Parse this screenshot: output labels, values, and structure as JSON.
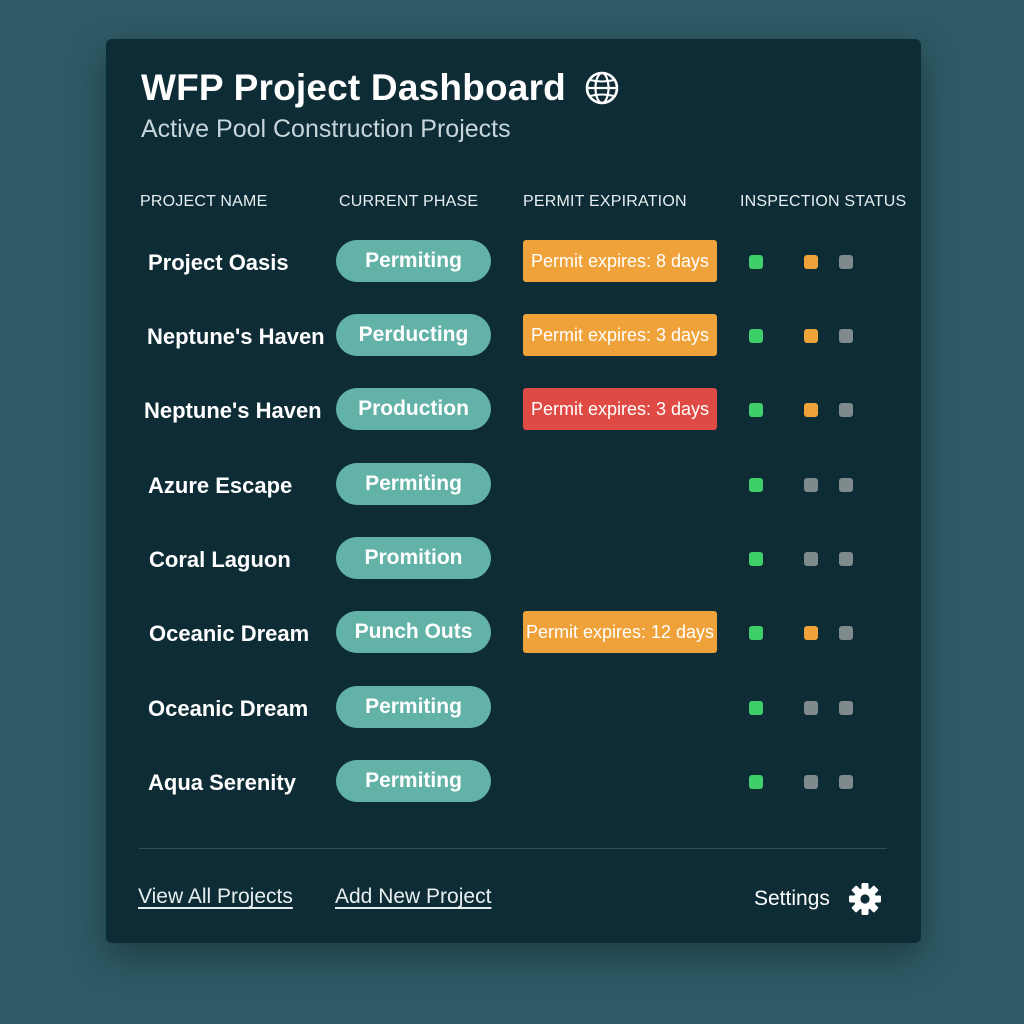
{
  "header": {
    "title": "WFP Project Dashboard",
    "subtitle": "Active Pool Construction Projects",
    "globe_icon": "globe-icon"
  },
  "columns": {
    "project_name": "PROJECT NAME",
    "current_phase": "CURRENT PHASE",
    "permit_expiration": "PERMIT EXPIRATION",
    "inspection_status": "INSPECTION STATUS"
  },
  "colors": {
    "background": "#2e5b66",
    "card": "#0e2c35",
    "phase_pill": "#62b2a7",
    "permit_warning": "#f0a23a",
    "permit_urgent": "#e04a45",
    "status_green": "#3ecf6a",
    "status_orange": "#f0a23a",
    "status_gray": "#7f8a8d"
  },
  "projects": [
    {
      "name": "Project Oasis",
      "phase": "Permiting",
      "permit": "Permit expires: 8 days",
      "permit_level": "warning",
      "inspection": [
        "green",
        "orange",
        "gray"
      ]
    },
    {
      "name": "Neptune's Haven",
      "phase": "Perducting",
      "permit": "Permit expires: 3 days",
      "permit_level": "warning",
      "inspection": [
        "green",
        "orange",
        "gray"
      ]
    },
    {
      "name": "Neptune's Haven",
      "phase": "Production",
      "permit": "Permit expires: 3 days",
      "permit_level": "urgent",
      "inspection": [
        "green",
        "orange",
        "gray"
      ]
    },
    {
      "name": "Azure Escape",
      "phase": "Permiting",
      "permit": "",
      "permit_level": "none",
      "inspection": [
        "green",
        "gray",
        "gray"
      ]
    },
    {
      "name": "Coral Laguon",
      "phase": "Promition",
      "permit": "",
      "permit_level": "none",
      "inspection": [
        "green",
        "gray",
        "gray"
      ]
    },
    {
      "name": "Oceanic Dream",
      "phase": "Punch Outs",
      "permit": "Permit expires: 12 days",
      "permit_level": "warning",
      "inspection": [
        "green",
        "orange",
        "gray"
      ]
    },
    {
      "name": "Oceanic Dream",
      "phase": "Permiting",
      "permit": "",
      "permit_level": "none",
      "inspection": [
        "green",
        "gray",
        "gray"
      ]
    },
    {
      "name": "Aqua Serenity",
      "phase": "Permiting",
      "permit": "",
      "permit_level": "none",
      "inspection": [
        "green",
        "gray",
        "gray"
      ]
    }
  ],
  "footer": {
    "view_all": "View All Projects",
    "add_new": "Add New Project",
    "settings": "Settings",
    "settings_icon": "gear-icon"
  }
}
